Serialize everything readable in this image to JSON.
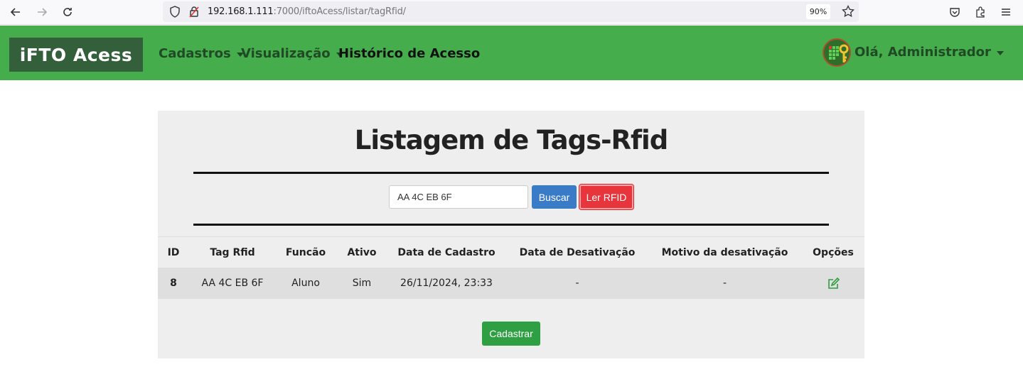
{
  "browser": {
    "url_host": "192.168.1.111",
    "url_rest": ":7000/iftoAcess/listar/tagRfid/",
    "zoom": "90%",
    "icons": [
      "back-arrow-icon",
      "forward-arrow-icon",
      "reload-icon",
      "shield-icon",
      "lock-slash-icon",
      "star-icon",
      "pocket-icon",
      "extensions-icon",
      "menu-icon"
    ]
  },
  "navbar": {
    "brand": "iFTO Acess",
    "links": [
      "Cadastros",
      "Visualização",
      "Histórico de Acesso"
    ],
    "user_greeting": "Olá, Administrador",
    "colors": {
      "bg": "#46ad4c",
      "brand_bg": "#33603a",
      "link": "#1f4a25"
    }
  },
  "page": {
    "title": "Listagem de Tags-Rfid",
    "search_value": "AA 4C EB 6F",
    "buscar_label": "Buscar",
    "ler_rfid_label": "Ler RFID",
    "cadastrar_label": "Cadastrar"
  },
  "table": {
    "headers": [
      "ID",
      "Tag Rfid",
      "Funcão",
      "Ativo",
      "Data de Cadastro",
      "Data de Desativação",
      "Motivo da desativação",
      "Opções"
    ],
    "rows": [
      {
        "id": "8",
        "tag": "AA 4C EB 6F",
        "funcao": "Aluno",
        "ativo": "Sim",
        "data_cadastro": "26/11/2024, 23:33",
        "data_desativacao": "-",
        "motivo": "-",
        "opcao_icon": "edit-icon"
      }
    ]
  }
}
